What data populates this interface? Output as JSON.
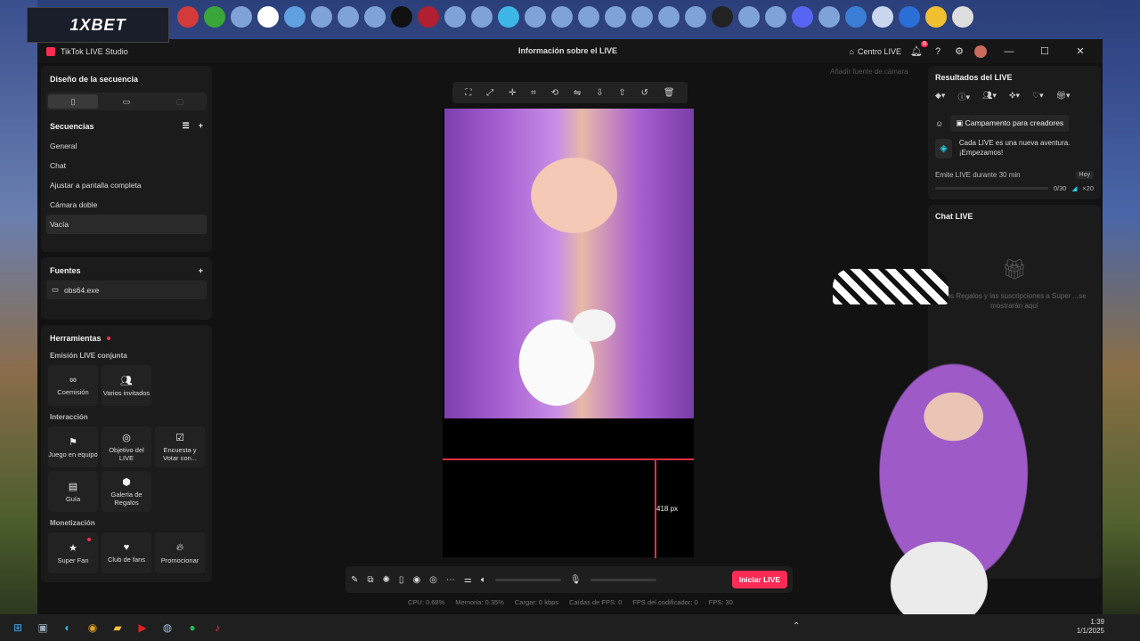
{
  "desktop": {
    "brand_logo": "1XBET",
    "pins": [
      {
        "name": "x-app-icon",
        "color": "#d33a3a"
      },
      {
        "name": "game-icon",
        "color": "#3aa63a"
      },
      {
        "name": "app-icon",
        "color": "#7fa2d8"
      },
      {
        "name": "capcut-icon",
        "color": "#ffffff"
      },
      {
        "name": "help-icon",
        "color": "#5fa0e0"
      },
      {
        "name": "app-icon",
        "color": "#7fa2d8"
      },
      {
        "name": "app-icon",
        "color": "#7fa2d8"
      },
      {
        "name": "app-icon",
        "color": "#7fa2d8"
      },
      {
        "name": "fc26-icon",
        "color": "#111111"
      },
      {
        "name": "valorant-icon",
        "color": "#b02030"
      },
      {
        "name": "app-icon",
        "color": "#7fa2d8"
      },
      {
        "name": "app-icon",
        "color": "#7fa2d8"
      },
      {
        "name": "diamond-icon",
        "color": "#3fb6e8"
      },
      {
        "name": "app-icon",
        "color": "#7fa2d8"
      },
      {
        "name": "app-icon",
        "color": "#7fa2d8"
      },
      {
        "name": "app-icon",
        "color": "#7fa2d8"
      },
      {
        "name": "app-icon",
        "color": "#7fa2d8"
      },
      {
        "name": "app-icon",
        "color": "#7fa2d8"
      },
      {
        "name": "app-icon",
        "color": "#7fa2d8"
      },
      {
        "name": "app-icon",
        "color": "#7fa2d8"
      },
      {
        "name": "obs-icon",
        "color": "#222222"
      },
      {
        "name": "app-icon",
        "color": "#7fa2d8"
      },
      {
        "name": "app-icon",
        "color": "#7fa2d8"
      },
      {
        "name": "discord-icon",
        "color": "#5865f2"
      },
      {
        "name": "app-icon",
        "color": "#7fa2d8"
      },
      {
        "name": "vscode-icon",
        "color": "#3a7fd5"
      },
      {
        "name": "app-icon",
        "color": "#c9d6ee"
      },
      {
        "name": "app-icon",
        "color": "#2a6fd5"
      },
      {
        "name": "app-icon",
        "color": "#f0c030"
      },
      {
        "name": "recycle-bin-icon",
        "color": "#dddddd"
      }
    ]
  },
  "window": {
    "app_title": "TikTok LIVE Studio",
    "center_title": "Información sobre el LIVE",
    "centro_live": "Centro LIVE",
    "notif_count": "8"
  },
  "left": {
    "layout_title": "Diseño de la secuencia",
    "sequences_title": "Secuencias",
    "sequences": [
      "General",
      "Chat",
      "Ajustar a pantalla completa",
      "Cámara doble",
      "Vacía"
    ],
    "active_sequence": 4,
    "sources_title": "Fuentes",
    "sources": [
      "obs64.exe"
    ],
    "tools_title": "Herramientas",
    "sections": {
      "joint": "Emisión LIVE conjunta",
      "interaction": "Interacción",
      "monetization": "Monetización"
    },
    "joint_tools": [
      {
        "label": "Coemisión",
        "icon": "link-icon"
      },
      {
        "label": "Varios invitados",
        "icon": "users-icon"
      }
    ],
    "interaction_tools": [
      {
        "label": "Juego en equipo",
        "icon": "team-icon"
      },
      {
        "label": "Objetivo del LIVE",
        "icon": "target-icon"
      },
      {
        "label": "Encuesta y Votar con...",
        "icon": "poll-icon"
      },
      {
        "label": "Guía",
        "icon": "guide-icon"
      },
      {
        "label": "Galería de Regalos",
        "icon": "gift-gallery-icon"
      }
    ],
    "monetization_tools": [
      {
        "label": "Super Fan",
        "icon": "star-icon"
      },
      {
        "label": "Club de fans",
        "icon": "heart-icon"
      },
      {
        "label": "Promocionar",
        "icon": "flame-icon"
      }
    ]
  },
  "canvas": {
    "add_camera": "Añadir fuente de cámara",
    "measure_label": "418 px"
  },
  "controls": {
    "go_live": "Iniciar LIVE"
  },
  "stats": {
    "cpu": "CPU: 0.68%",
    "memory": "Memoria: 0.35%",
    "load": "Cargar: 0 kbps",
    "fps_drops": "Caídas de FPS: 0",
    "encoder": "FPS del codificador: 0",
    "fps": "FPS: 30"
  },
  "right": {
    "results_title": "Resultados del LIVE",
    "campaign_label": "Campamento para creadores",
    "adventure_text": "Cada LIVE es una nueva aventura. ¡Empezamos!",
    "task_label": "Emite LIVE durante 30 min",
    "task_badge": "Hoy",
    "progress_text": "0/30",
    "progress_fraction": 0,
    "reward_text": "×20",
    "chat_title": "Chat LIVE",
    "chat_empty": "Los Regalos y las suscripciones a Super ...se mostrarán aquí"
  },
  "clock": {
    "time": "1:39",
    "date": "1/1/2025"
  }
}
